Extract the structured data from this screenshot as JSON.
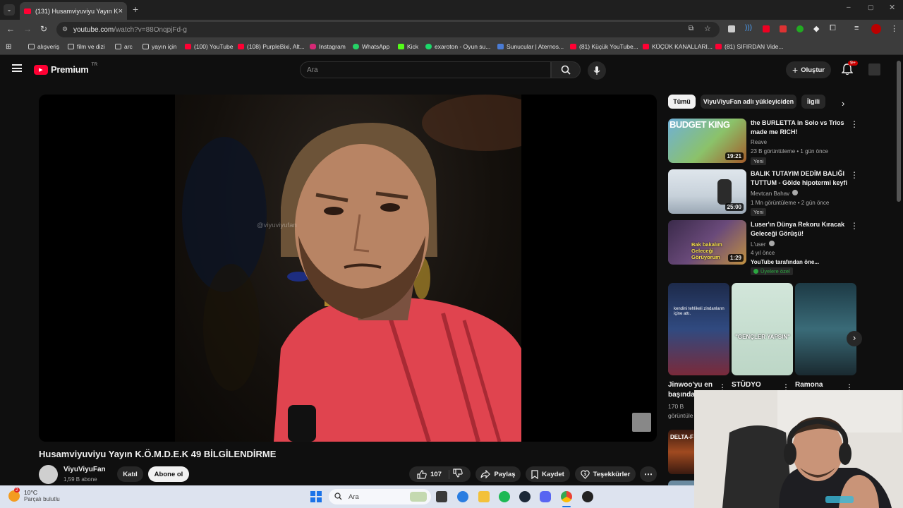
{
  "browser": {
    "tab_title": "(131) Husamviyuviyu Yayın K.Ö.M.D",
    "url_host": "youtube.com",
    "url_path": "/watch?v=88OnqpjFd-g"
  },
  "bookmarks": [
    {
      "label": "alışveriş",
      "icon": "folder-icon"
    },
    {
      "label": "film ve dizi",
      "icon": "folder-icon"
    },
    {
      "label": "arc",
      "icon": "folder-icon"
    },
    {
      "label": "yayın için",
      "icon": "folder-icon"
    },
    {
      "label": "(100) YouTube",
      "icon": "youtube-icon"
    },
    {
      "label": "(108) PurpleBixi, Alt...",
      "icon": "youtube-icon"
    },
    {
      "label": "Instagram",
      "icon": "instagram-icon"
    },
    {
      "label": "WhatsApp",
      "icon": "whatsapp-icon"
    },
    {
      "label": "Kick",
      "icon": "kick-icon"
    },
    {
      "label": "exaroton - Oyun su...",
      "icon": "exaroton-icon"
    },
    {
      "label": "Sunucular | Aternos...",
      "icon": "aternos-icon"
    },
    {
      "label": "(81) Küçük YouTube...",
      "icon": "youtube-icon"
    },
    {
      "label": "KÜÇÜK KANALLARI...",
      "icon": "youtube-icon"
    },
    {
      "label": "(81) SIFIRDAN Vide...",
      "icon": "youtube-icon"
    }
  ],
  "yt": {
    "logo_text": "Premium",
    "logo_region": "TR",
    "search_placeholder": "Ara",
    "create_label": "Oluştur",
    "notif_count": "9+",
    "accent": "#ff0033"
  },
  "video": {
    "watermark": "@viyuviyufan",
    "title": "Husamviyuviyu Yayın K.Ö.M.D.E.K 49 BİLGİLENDİRME",
    "channel": "ViyuViyuFan",
    "subscribers": "1,59 B abone",
    "join_label": "Katıl",
    "subscribe_label": "Abone ol",
    "likes": "107",
    "share_label": "Paylaş",
    "save_label": "Kaydet",
    "thanks_label": "Teşekkürler"
  },
  "chips": [
    "Tümü",
    "ViyuViyuFan adlı yükleyiciden",
    "İlgili"
  ],
  "recommendations": [
    {
      "thumb_text": "BUDGET KING",
      "duration": "19:21",
      "title": "the BURLETTA in Solo vs Trios made me RICH!",
      "channel": "Reave",
      "meta": "23 B görüntüleme • 1 gün önce",
      "badge": "Yeni"
    },
    {
      "duration": "25:00",
      "title": "BALIK TUTAYIM DEDİM BALIĞI TUTTUM - Gölde hipotermi keyfi",
      "channel": "Mevtcan Bahav",
      "meta": "1 Mn görüntüleme • 2 gün önce",
      "badge": "Yeni"
    },
    {
      "thumb_text": "Bak bakalım Geleceği Görüyorum",
      "duration": "1:29",
      "title": "Luser'ın Dünya Rekoru Kıracak Geleceği Görüşü!",
      "channel": "L'user",
      "meta": "4 yıl önce",
      "promo": "YouTube tarafından öne...",
      "members": "Üyelere özel"
    }
  ],
  "shorts": [
    {
      "title": "Jinwoo'yu en başında",
      "views": "170 B",
      "views2": "görüntüle",
      "overlay": "kendini tehlikeli zindanların içine attı."
    },
    {
      "title": "STÜDYO",
      "overlay": "\"GENÇLER YAPSIN\""
    },
    {
      "title": "Ramona"
    }
  ],
  "partial_thumb_text": "DELTA-F",
  "taskbar": {
    "weather_temp": "10°C",
    "weather_desc": "Parçalı bulutlu",
    "weather_badge": "2",
    "search_label": "Ara"
  }
}
